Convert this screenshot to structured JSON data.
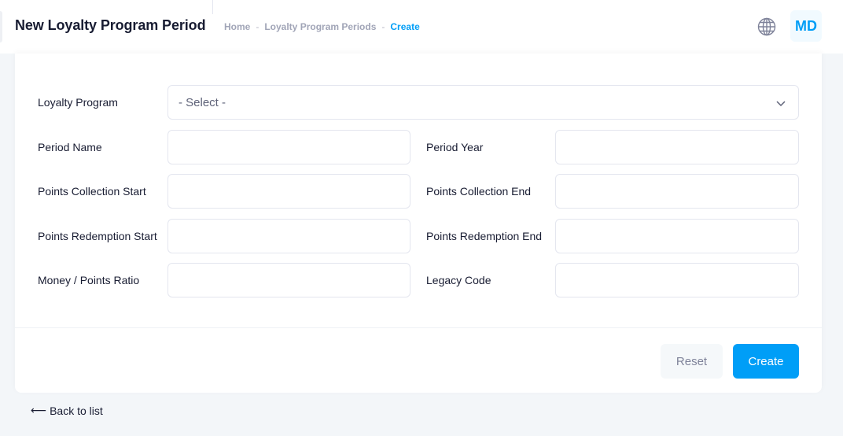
{
  "header": {
    "page_title": "New Loyalty Program Period",
    "breadcrumb": {
      "home": "Home",
      "separator": "-",
      "section": "Loyalty Program Periods",
      "current": "Create"
    },
    "language_icon": "globe-icon",
    "avatar_initials": "MD"
  },
  "form": {
    "loyalty_program": {
      "label": "Loyalty Program",
      "value": "- Select -"
    },
    "period_name": {
      "label": "Period Name",
      "value": ""
    },
    "period_year": {
      "label": "Period Year",
      "value": ""
    },
    "points_collection_start": {
      "label": "Points Collection Start",
      "value": ""
    },
    "points_collection_end": {
      "label": "Points Collection End",
      "value": ""
    },
    "points_redemption_start": {
      "label": "Points Redemption Start",
      "value": ""
    },
    "points_redemption_end": {
      "label": "Points Redemption End",
      "value": ""
    },
    "money_points_ratio": {
      "label": "Money / Points Ratio",
      "value": ""
    },
    "legacy_code": {
      "label": "Legacy Code",
      "value": ""
    }
  },
  "actions": {
    "reset_label": "Reset",
    "create_label": "Create"
  },
  "back_link": {
    "arrow": "⟵",
    "label": "Back to list"
  },
  "colors": {
    "accent": "#009ef7",
    "background": "#f3f6f9",
    "border": "#e4e6ef"
  }
}
